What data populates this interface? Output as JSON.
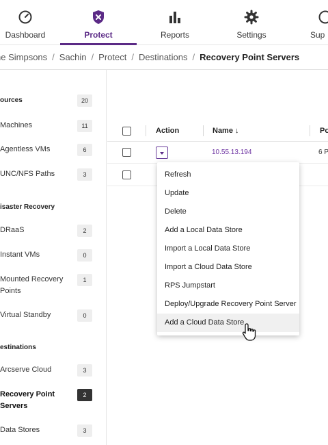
{
  "nav": {
    "items": [
      {
        "label": "Dashboard",
        "icon": "gauge-icon"
      },
      {
        "label": "Protect",
        "icon": "shield-icon",
        "active": true
      },
      {
        "label": "Reports",
        "icon": "bar-chart-icon"
      },
      {
        "label": "Settings",
        "icon": "gear-icon"
      },
      {
        "label": "Sup",
        "icon": "support-icon"
      }
    ]
  },
  "breadcrumb": [
    "ne Simpsons",
    "Sachin",
    "Protect",
    "Destinations",
    "Recovery Point Servers"
  ],
  "sidebar": {
    "sources_header": {
      "label": "ources",
      "count": "20"
    },
    "machines": {
      "label": "Machines",
      "count": "11"
    },
    "agentless": {
      "label": "Agentless VMs",
      "count": "6"
    },
    "unc": {
      "label": "UNC/NFS Paths",
      "count": "3"
    },
    "dr_header": {
      "label": "isaster Recovery"
    },
    "draas": {
      "label": "DRaaS",
      "count": "2"
    },
    "instant": {
      "label": "Instant VMs",
      "count": "0"
    },
    "mounted": {
      "label": "Mounted Recovery Points",
      "count": "1"
    },
    "virtual": {
      "label": "Virtual Standby",
      "count": "0"
    },
    "dest_header": {
      "label": "estinations"
    },
    "arcserve": {
      "label": "Arcserve Cloud",
      "count": "3"
    },
    "rps": {
      "label": "Recovery Point Servers",
      "count": "2"
    },
    "datastores": {
      "label": "Data Stores",
      "count": "3"
    }
  },
  "table": {
    "headers": {
      "action": "Action",
      "name": "Name ↓",
      "ports": "Po"
    },
    "rows": [
      {
        "name": "10.55.13.194",
        "ports": "6 P"
      },
      {
        "name": "",
        "ports": ""
      }
    ]
  },
  "action_menu": {
    "items": [
      "Refresh",
      "Update",
      "Delete",
      "Add a Local Data Store",
      "Import a Local Data Store",
      "Import a Cloud Data Store",
      "RPS Jumpstart",
      "Deploy/Upgrade Recovery Point Server",
      "Add a Cloud Data Store"
    ]
  },
  "colors": {
    "brand": "#5b2a86",
    "link": "#6a2fa0"
  }
}
